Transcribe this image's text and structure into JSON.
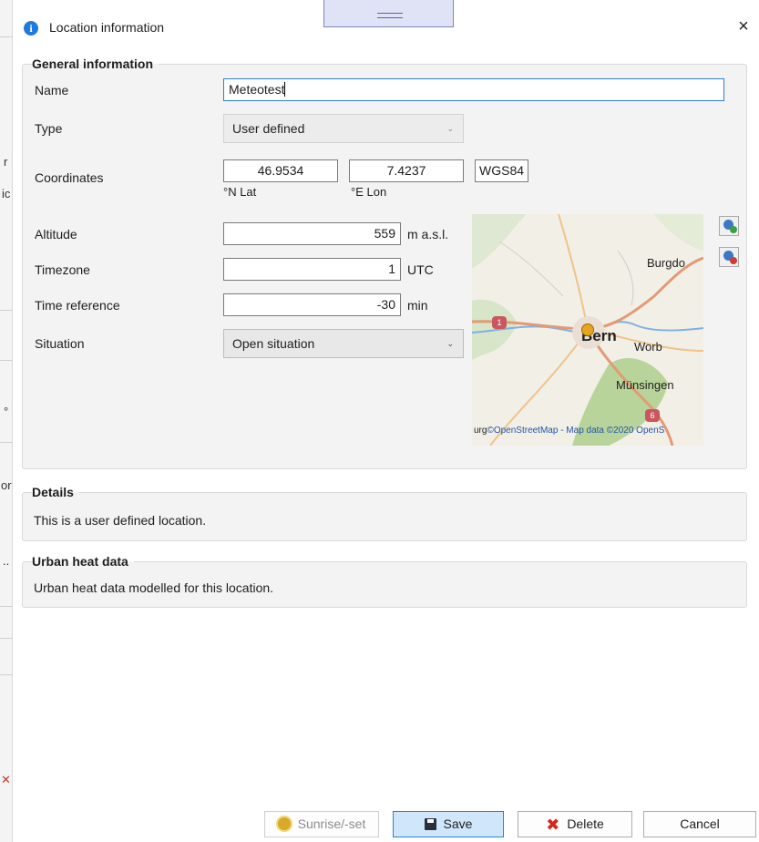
{
  "window": {
    "title": "Location information",
    "close_label": "×"
  },
  "general": {
    "title": "General information",
    "name_label": "Name",
    "name_value": "Meteotest",
    "type_label": "Type",
    "type_value": "User defined",
    "coords_label": "Coordinates",
    "lat_value": "46.9534",
    "lon_value": "7.4237",
    "lat_caption": "°N Lat",
    "lon_caption": "°E Lon",
    "crs_value": "WGS84",
    "altitude_label": "Altitude",
    "altitude_value": "559",
    "altitude_unit": "m a.s.l.",
    "timezone_label": "Timezone",
    "timezone_value": "1",
    "timezone_unit": "UTC",
    "timeref_label": "Time reference",
    "timeref_value": "-30",
    "timeref_unit": "min",
    "situation_label": "Situation",
    "situation_value": "Open situation"
  },
  "map": {
    "labels": {
      "burgdorf": "Burgdo",
      "bern": "Bern",
      "worb": "Worb",
      "munsingen": "Münsingen"
    },
    "shields": {
      "a1": "1",
      "a6": "6"
    },
    "attribution": "©OpenStreetMap - Map data ©2020 OpenS",
    "edge_text": "urg",
    "search_icon": "map-search-add-icon",
    "remove_icon": "map-search-remove-icon"
  },
  "details": {
    "title": "Details",
    "text": "This is a user defined location."
  },
  "urban": {
    "title": "Urban heat data",
    "text": "Urban heat data modelled for this location."
  },
  "buttons": {
    "sunrise": "Sunrise/-set",
    "save": "Save",
    "delete": "Delete",
    "cancel": "Cancel"
  },
  "background": {
    "glyphs": [
      "r",
      "ic",
      "°",
      "or",
      ".."
    ]
  },
  "colors": {
    "accent": "#2a83d8",
    "delete": "#d8261f",
    "map_bg": "#f2efe6"
  }
}
